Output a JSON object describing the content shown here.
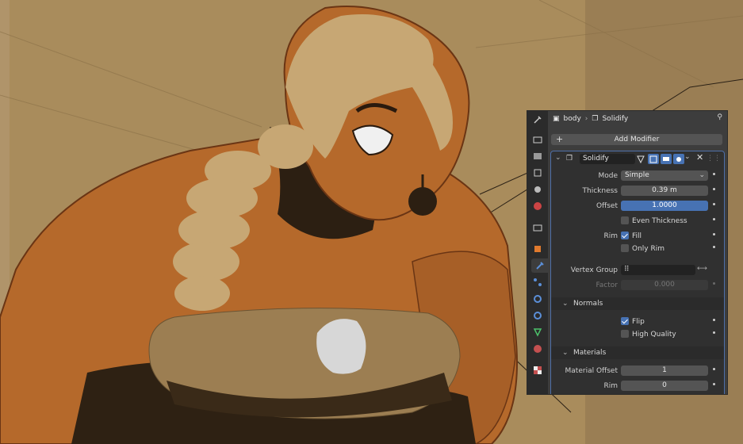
{
  "breadcrumb": {
    "object": "body",
    "modifier": "Solidify"
  },
  "add_modifier_label": "Add Modifier",
  "modifier": {
    "name": "Solidify",
    "mode_label": "Mode",
    "mode_value": "Simple",
    "thickness_label": "Thickness",
    "thickness_value": "0.39 m",
    "offset_label": "Offset",
    "offset_value": "1.0000",
    "even_thickness_label": "Even Thickness",
    "even_thickness_checked": false,
    "rim_label": "Rim",
    "fill_label": "Fill",
    "fill_checked": true,
    "only_rim_label": "Only Rim",
    "only_rim_checked": false,
    "vertex_group_label": "Vertex Group",
    "vertex_group_value": "",
    "factor_label": "Factor",
    "factor_value": "0.000",
    "normals": {
      "section_label": "Normals",
      "flip_label": "Flip",
      "flip_checked": true,
      "high_quality_label": "High Quality",
      "high_quality_checked": false
    },
    "materials": {
      "section_label": "Materials",
      "material_offset_label": "Material Offset",
      "material_offset_value": "1",
      "rim_label": "Rim",
      "rim_value": "0"
    }
  },
  "property_tabs": [
    "tool-icon",
    "render-icon",
    "output-icon",
    "view-layer-icon",
    "scene-icon",
    "world-icon",
    "collection-icon",
    "object-icon",
    "modifier-icon",
    "particles-icon",
    "physics-icon",
    "constraints-icon",
    "data-icon",
    "material-icon",
    "texture-icon"
  ],
  "colors": {
    "accent": "#4772b3",
    "panel_bg": "#3d3d3d",
    "wall": "#a98c5c",
    "skin": "#b5692b"
  }
}
